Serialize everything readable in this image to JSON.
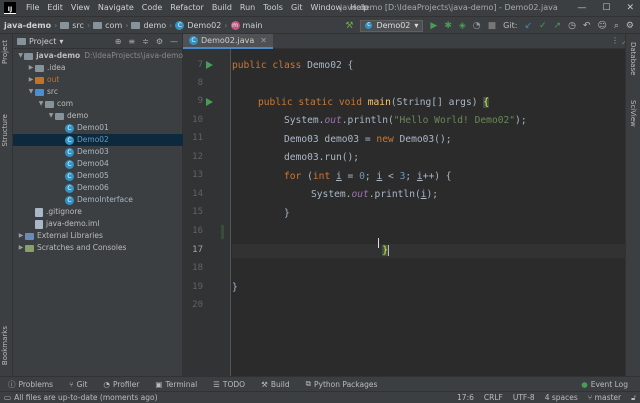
{
  "menubar": {
    "logo": "IJ",
    "items": [
      "File",
      "Edit",
      "View",
      "Navigate",
      "Code",
      "Refactor",
      "Build",
      "Run",
      "Tools",
      "Git",
      "Window",
      "Help"
    ],
    "title": "java-demo [D:\\IdeaProjects\\java-demo] - Demo02.java",
    "min": "—",
    "max": "☐",
    "close": "✕"
  },
  "navbar": {
    "crumbs": [
      "java-demo",
      "src",
      "com",
      "demo",
      "Demo02",
      "main"
    ],
    "run_config": "Demo02",
    "git_label": "Git:"
  },
  "leftstripe": {
    "project": "Project",
    "structure": "Structure",
    "bookmarks": "Bookmarks"
  },
  "project": {
    "title": "Project",
    "tree": [
      {
        "label": "java-demo",
        "path": "D:\\IdeaProjects\\java-demo",
        "indent": 0,
        "arrow": "▼",
        "kind": "folder"
      },
      {
        "label": ".idea",
        "indent": 1,
        "arrow": "▶",
        "kind": "folder"
      },
      {
        "label": "out",
        "indent": 1,
        "arrow": "▶",
        "kind": "folder-orange"
      },
      {
        "label": "src",
        "indent": 1,
        "arrow": "▼",
        "kind": "folder-blue"
      },
      {
        "label": "com",
        "indent": 2,
        "arrow": "▼",
        "kind": "folder"
      },
      {
        "label": "demo",
        "indent": 3,
        "arrow": "▼",
        "kind": "folder"
      },
      {
        "label": "Demo01",
        "indent": 4,
        "kind": "class"
      },
      {
        "label": "Demo02",
        "indent": 4,
        "kind": "class",
        "selected": true
      },
      {
        "label": "Demo03",
        "indent": 4,
        "kind": "class"
      },
      {
        "label": "Demo04",
        "indent": 4,
        "kind": "class"
      },
      {
        "label": "Demo05",
        "indent": 4,
        "kind": "class"
      },
      {
        "label": "Demo06",
        "indent": 4,
        "kind": "class"
      },
      {
        "label": "DemoInterface",
        "indent": 4,
        "kind": "class"
      },
      {
        "label": ".gitignore",
        "indent": 1,
        "kind": "file"
      },
      {
        "label": "java-demo.iml",
        "indent": 1,
        "kind": "file"
      },
      {
        "label": "External Libraries",
        "indent": 0,
        "arrow": "▶",
        "kind": "lib"
      },
      {
        "label": "Scratches and Consoles",
        "indent": 0,
        "arrow": "▶",
        "kind": "scratch"
      }
    ]
  },
  "editor": {
    "tab_label": "Demo02.java",
    "line_numbers": [
      "7",
      "8",
      "9",
      "10",
      "11",
      "12",
      "13",
      "14",
      "15",
      "16",
      "17",
      "18",
      "19",
      "20"
    ],
    "current_line": "17"
  },
  "rightstripe": {
    "database": "Database",
    "sciview": "SciView"
  },
  "bottombar": {
    "tools": [
      "Problems",
      "Git",
      "Profiler",
      "Terminal",
      "TODO",
      "Build",
      "Python Packages"
    ],
    "event_log": "Event Log"
  },
  "statusbar": {
    "message": "All files are up-to-date (moments ago)",
    "position": "17:6",
    "line_sep": "CRLF",
    "encoding": "UTF-8",
    "indent": "4 spaces",
    "branch": "master"
  },
  "colors": {
    "accent": "#4a88c7",
    "keyword": "#cc7832",
    "string": "#6a8759",
    "function": "#ffc66d"
  }
}
